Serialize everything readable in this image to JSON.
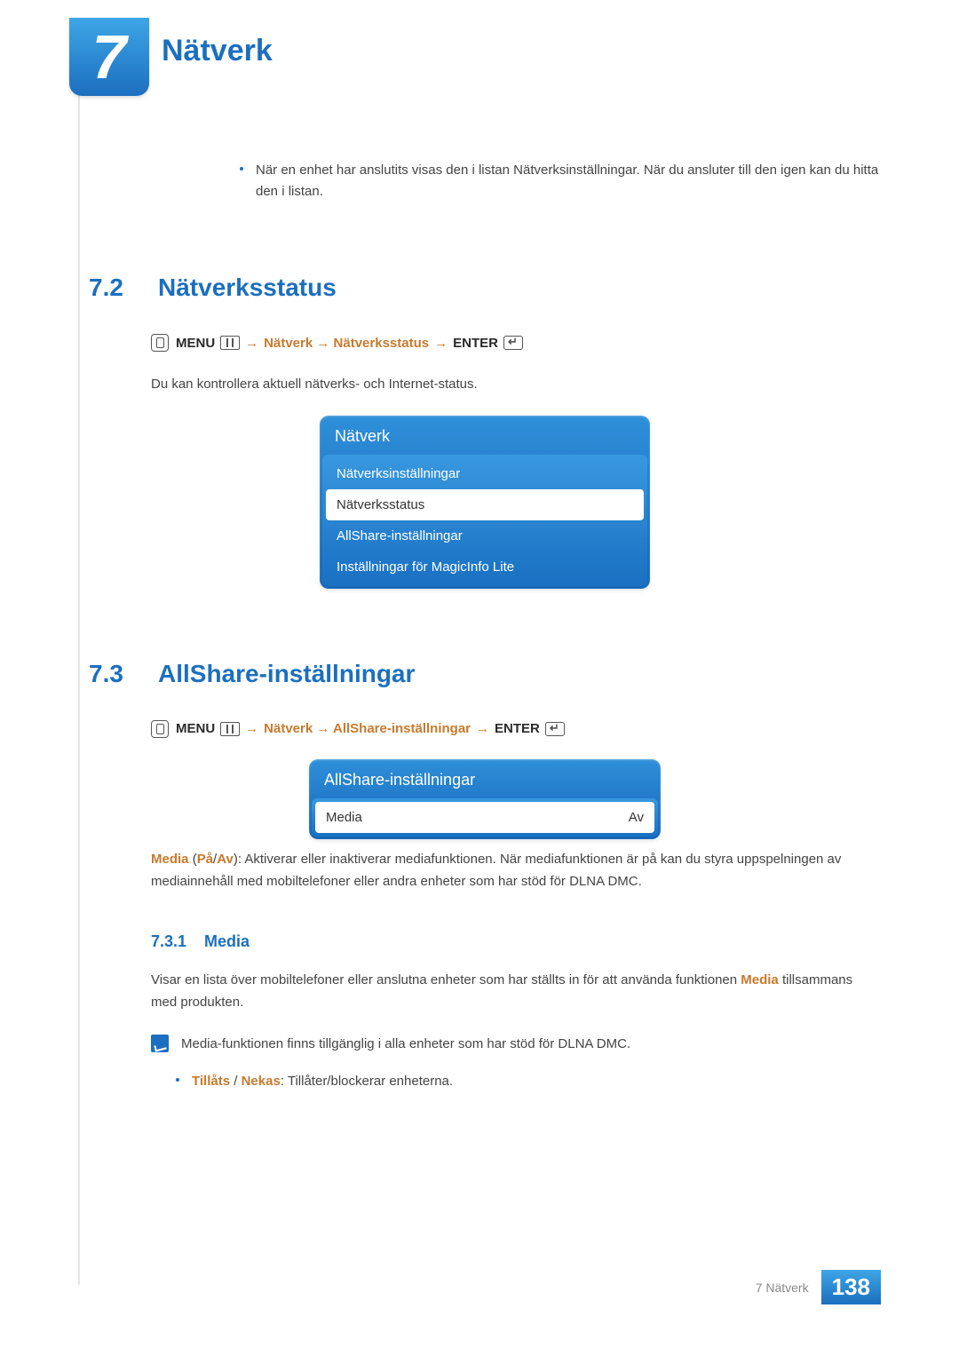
{
  "chapter": {
    "number": "7",
    "title": "Nätverk"
  },
  "intro_bullet": "När en enhet har anslutits visas den i listan Nätverksinställningar. När du ansluter till den igen kan du hitta den i listan.",
  "sec72": {
    "num": "7.2",
    "title": "Nätverksstatus",
    "menu_label": "MENU",
    "arrow": "→",
    "path": "Nätverk → Nätverksstatus",
    "enter_label": "ENTER",
    "desc": "Du kan kontrollera aktuell nätverks- och Internet-status.",
    "panel_title": "Nätverk",
    "items": [
      {
        "label": "Nätverksinställningar",
        "selected": false
      },
      {
        "label": "Nätverksstatus",
        "selected": true
      },
      {
        "label": "AllShare-inställningar",
        "selected": false
      },
      {
        "label": "Inställningar för MagicInfo Lite",
        "selected": false
      }
    ]
  },
  "sec73": {
    "num": "7.3",
    "title": "AllShare-inställningar",
    "menu_label": "MENU",
    "arrow": "→",
    "path": "Nätverk → AllShare-inställningar",
    "enter_label": "ENTER",
    "panel_title": "AllShare-inställningar",
    "item_label": "Media",
    "item_value": "Av",
    "media_bold": "Media",
    "media_paren_on": "På",
    "media_paren_sep": "/",
    "media_paren_off": "Av",
    "media_desc_tail": "): Aktiverar eller inaktiverar mediafunktionen. När mediafunktionen är på kan du styra uppspelningen av mediainnehåll med mobiltelefoner eller andra enheter som har stöd för DLNA DMC."
  },
  "sec731": {
    "num": "7.3.1",
    "title": "Media",
    "line1_pre": "Visar en lista över mobiltelefoner eller anslutna enheter som har ställts in för att använda funktionen ",
    "line1_bold": "Media",
    "line1_post": " tillsammans med produkten.",
    "note": "Media-funktionen finns tillgänglig i alla enheter som har stöd för DLNA DMC.",
    "bullet_allow": "Tillåts",
    "bullet_sep": " / ",
    "bullet_deny": "Nekas",
    "bullet_tail": ": Tillåter/blockerar enheterna."
  },
  "footer": {
    "text": "7 Nätverk",
    "page": "138"
  }
}
